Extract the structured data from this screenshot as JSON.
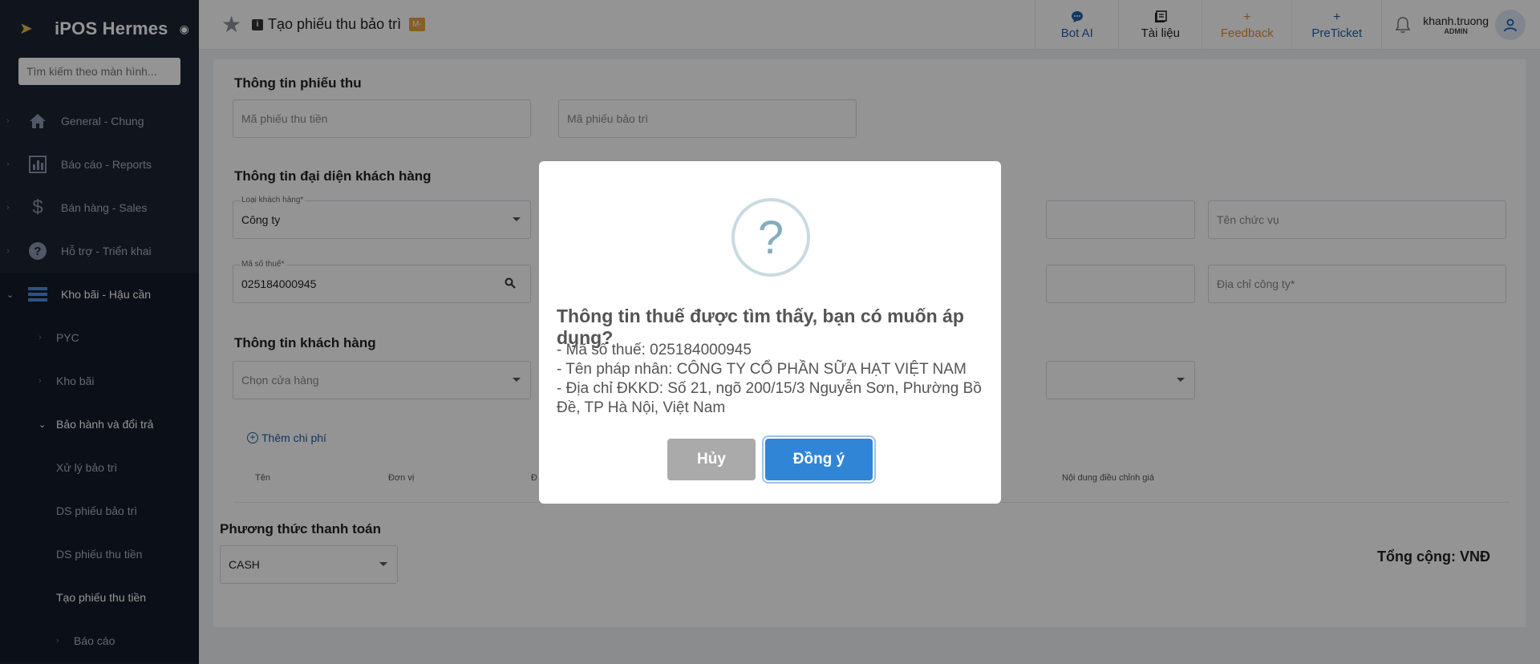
{
  "sidebar": {
    "brand": "iPOS Hermes",
    "search_placeholder": "Tìm kiếm theo màn hình...",
    "items": [
      {
        "label": "General - Chung"
      },
      {
        "label": "Báo cáo - Reports"
      },
      {
        "label": "Bán hàng - Sales"
      },
      {
        "label": "Hỗ trợ - Triển khai"
      },
      {
        "label": "Kho bãi - Hậu cần"
      },
      {
        "label": "PYC"
      },
      {
        "label": "Kho bãi"
      },
      {
        "label": "Bảo hành và đổi trả"
      },
      {
        "label": "Xử lý bảo trì"
      },
      {
        "label": "DS phiếu bảo trì"
      },
      {
        "label": "DS phiếu thu tiền"
      },
      {
        "label": "Tạo phiếu thu tiền"
      },
      {
        "label": "Báo cáo"
      }
    ]
  },
  "topbar": {
    "title": "Tạo phiếu thu bảo trì",
    "badge": "M-",
    "bot_label": "Bot AI",
    "doc_label": "Tài liệu",
    "feedback_label": "Feedback",
    "preticket_label": "PreTicket",
    "user_name": "khanh.truong",
    "user_role": "ADMIN"
  },
  "form": {
    "section1": "Thông tin phiếu thu",
    "receipt_code_placeholder": "Mã phiếu thu tiền",
    "maint_code_placeholder": "Mã phiếu bảo trì",
    "section2": "Thông tin đại diện khách hàng",
    "customer_type_label": "Loại khách hàng*",
    "customer_type_value": "Công ty",
    "position_placeholder": "Tên chức vụ",
    "tax_label": "Mã số thuế*",
    "tax_value": "025184000945",
    "company_address_placeholder": "Địa chỉ công ty*",
    "section3": "Thông tin khách hàng",
    "store_placeholder": "Chọn cửa hàng",
    "add_cost": "Thêm chi phí",
    "col_name": "Tên",
    "col_unit": "Đơn vị",
    "col_partial": "Đ",
    "col_adjust": "Nội dung điều chỉnh giá",
    "payment_title": "Phương thức thanh toán",
    "payment_value": "CASH",
    "total": "Tổng cộng: VNĐ"
  },
  "modal": {
    "icon_char": "?",
    "title": "Thông tin thuế được tìm thấy, bạn có muốn áp dụng?",
    "line1": "- Mã số thuế: 025184000945",
    "line2": "- Tên pháp nhân: CÔNG TY CỔ PHẦN SỮA HẠT VIỆT NAM",
    "line3": "- Địa chỉ ĐKKD: Số 21, ngõ 200/15/3 Nguyễn Sơn, Phường Bồ Đề, TP Hà Nội, Việt Nam",
    "cancel_label": "Hủy",
    "ok_label": "Đồng ý"
  },
  "colors": {
    "sidebar_bg": "#1b2333",
    "accent": "#3085d6",
    "feedback": "#e8892c"
  }
}
